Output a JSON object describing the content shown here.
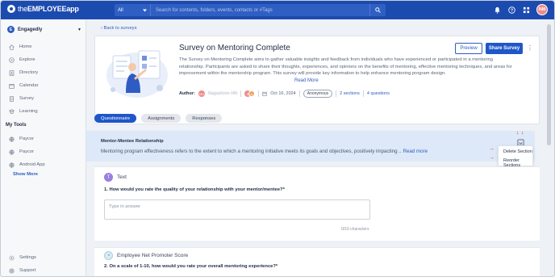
{
  "app": {
    "brand_prefix": "the",
    "brand_name": "EMPLOYEEapp",
    "user_initials": "NM"
  },
  "search": {
    "scope": "All",
    "placeholder": "Search for contents, folders, events, contacts or #Tags"
  },
  "sidebar": {
    "workspace": "Engagedly",
    "items": [
      {
        "label": "Home",
        "icon": "home-icon"
      },
      {
        "label": "Explore",
        "icon": "compass-icon"
      },
      {
        "label": "Directory",
        "icon": "directory-icon"
      },
      {
        "label": "Calendar",
        "icon": "calendar-icon"
      },
      {
        "label": "Survey",
        "icon": "survey-icon"
      },
      {
        "label": "Learning",
        "icon": "learning-icon"
      }
    ],
    "tools_heading": "My Tools",
    "tools": [
      {
        "label": "Paycor",
        "icon": "link-icon"
      },
      {
        "label": "Paycor",
        "icon": "link-icon"
      },
      {
        "label": "Android App",
        "icon": "link-icon"
      }
    ],
    "show_more": "Show More",
    "bottom": [
      {
        "label": "Settings",
        "icon": "gear-icon"
      },
      {
        "label": "Support",
        "icon": "support-icon"
      }
    ]
  },
  "main": {
    "back_link": "Back to surveys",
    "survey": {
      "title": "Survey on Mentoring Complete",
      "description": "The Survey on Mentoring Complete aims to gather valuable insights and feedback from individuals who have experienced or participated in a mentoring relationship. Participants are asked to share their thoughts, experiences, and opinions on the benefits of mentoring, effective mentoring techniques, and areas for improvement within the mentorship program. This survey will provide key information to help enhance mentoring program design.",
      "read_more": "Read More",
      "author_label": "Author:",
      "author_name": "Nagashree HN",
      "date": "Oct 16, 2024",
      "anonymous": "Anonymous",
      "sections": "2 sections",
      "questions": "4 questions",
      "preview_label": "Preview",
      "share_label": "Share Survey"
    },
    "tabs": [
      "Questionnaire",
      "Assignments",
      "Responses"
    ],
    "section": {
      "title": "Mentor-Mentee Relationship",
      "description": "Mentoring program effectiveness refers to the extent to which a mentoring initiative meets its goals and objectives, positively impacting ..",
      "read_more": "Read more",
      "menu": [
        "Delete Section",
        "Reorder Sections"
      ]
    },
    "question1": {
      "type": "Text",
      "type_letter": "T",
      "text": "1. How would you rate the quality of your relationship with your mentor/mentee?*",
      "placeholder": "Type in answer",
      "counter": "0/10 characters"
    },
    "question2": {
      "type": "Employee Net Promoter Score",
      "text": "2. On a scale of 1-10, how would you rate your overall mentoring experience?*"
    }
  }
}
